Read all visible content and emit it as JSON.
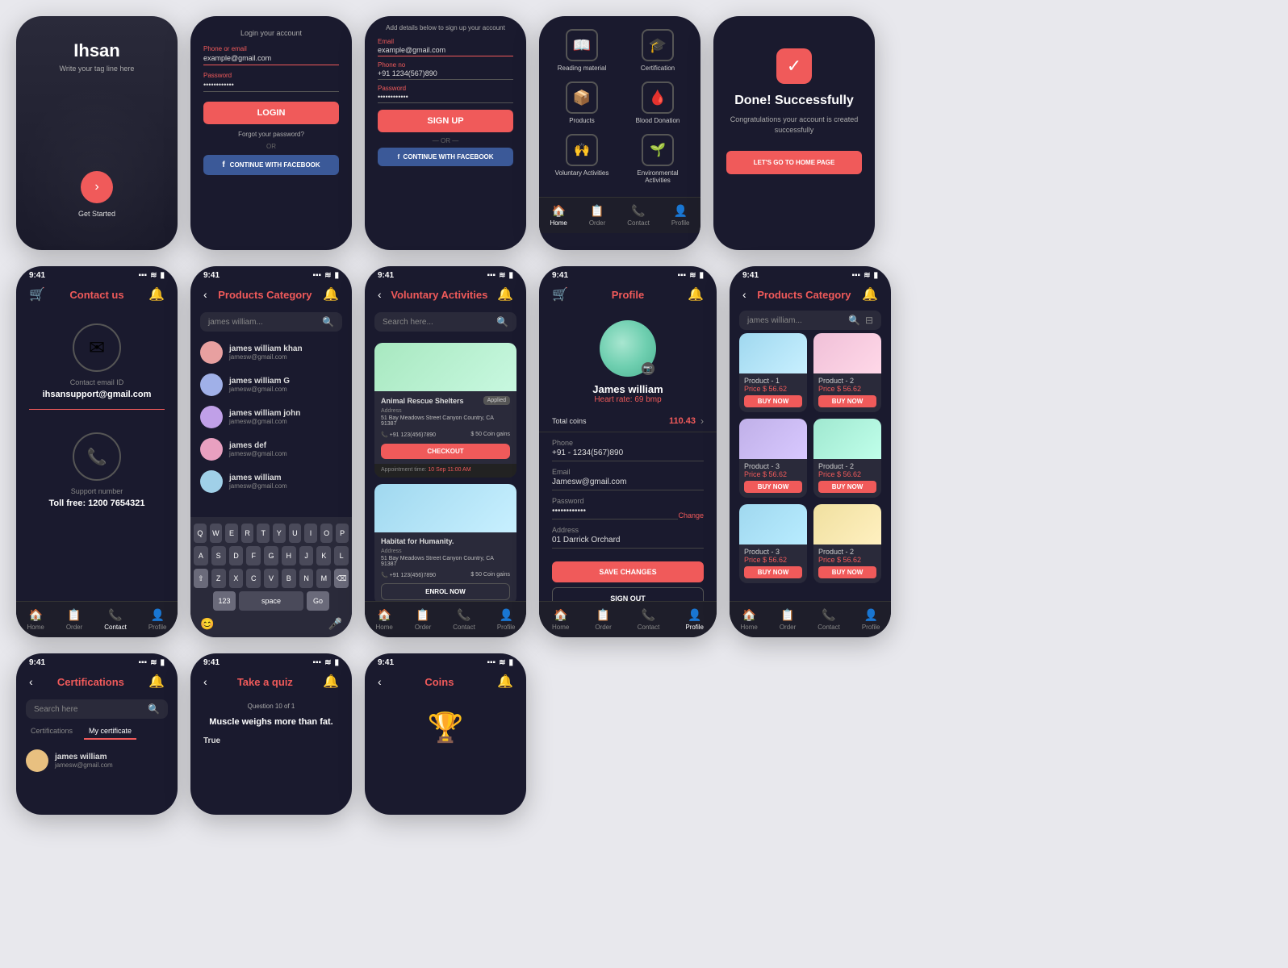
{
  "screens": {
    "welcome": {
      "title": "Ihsan",
      "subtitle": "Write your tag line here",
      "cta": "Get Started"
    },
    "login": {
      "topText": "Login your account",
      "emailLabel": "Phone or email",
      "emailPlaceholder": "example@gmail.com",
      "passwordLabel": "Password",
      "passwordValue": "••••••••••••",
      "loginBtn": "LOGIN",
      "forgotText": "Forgot your password?",
      "orText": "OR",
      "facebookBtn": "CONTINUE WITH FACEBOOK"
    },
    "signup": {
      "topText": "Add details below to sign up your account",
      "emailLabel": "Email",
      "emailPlaceholder": "example@gmail.com",
      "phoneLabel": "Phone no",
      "phonePlaceholder": "+91  1234(567)890",
      "passwordLabel": "Password",
      "passwordValue": "••••••••••••",
      "signupBtn": "SIGN UP",
      "orText": "OR",
      "facebookBtn": "CONTINUE WITH FACEBOOK"
    },
    "categories": {
      "items": [
        {
          "icon": "📖",
          "label": "Reading material"
        },
        {
          "icon": "🎓",
          "label": "Certification"
        },
        {
          "icon": "📦",
          "label": "Products"
        },
        {
          "icon": "🩸",
          "label": "Blood Donation"
        },
        {
          "icon": "🙌",
          "label": "Voluntary Activities"
        },
        {
          "icon": "🌱",
          "label": "Environmental Activities"
        }
      ],
      "bottomNav": [
        "Home",
        "Order",
        "Contact",
        "Profile"
      ]
    },
    "success": {
      "icon": "✓",
      "title": "Done! Successfully",
      "subtitle": "Congratulations your account is created successfully",
      "btn": "LET'S GO TO HOME PAGE"
    },
    "contactUs": {
      "title": "Contact us",
      "emailIcon": "✉",
      "emailLabel": "Contact email ID",
      "email": "ihsansupport@gmail.com",
      "phoneIcon": "📞",
      "phoneLabel": "Support number",
      "phone": "Toll free: 1200 7654321",
      "bottomNav": [
        "Home",
        "Order",
        "Contact",
        "Profile"
      ]
    },
    "productsCategory1": {
      "title": "Products Category",
      "searchPlaceholder": "james william...",
      "contacts": [
        {
          "name": "james william khan",
          "email": "jamesw@gmail.com",
          "color": "#e8a0a0"
        },
        {
          "name": "james william G",
          "email": "jamesw@gmail.com",
          "color": "#a0b0e8"
        },
        {
          "name": "james william john",
          "email": "jamesw@gmail.com",
          "color": "#c0a0e8"
        },
        {
          "name": "james def",
          "email": "jamesw@gmail.com",
          "color": "#e8a0c0"
        },
        {
          "name": "james william",
          "email": "jamesw@gmail.com",
          "color": "#a0d0e8"
        }
      ]
    },
    "voluntaryActivities": {
      "title": "Voluntary Activities",
      "searchPlaceholder": "Search here...",
      "items": [
        {
          "name": "Animal Rescue Shelters",
          "tag": "Applied",
          "address": "51 Bay Meadows Street Canyon Country, CA 91387",
          "phone": "+91 123(456)7890",
          "coins": "50 Coin gains",
          "checkoutBtn": "CHECKOUT",
          "appointmentTime": "10 Sep 11:00 AM"
        },
        {
          "name": "Habitat for Humanity.",
          "address": "51 Bay Meadows Street Canyon Country, CA 91387",
          "phone": "+91 123(456)7890",
          "coins": "50 Coin gains",
          "enrollBtn": "ENROL NOW"
        }
      ],
      "bottomNav": [
        "Home",
        "Order",
        "Contact",
        "Profile"
      ]
    },
    "profile": {
      "title": "Profile",
      "name": "James william",
      "heartRate": "Heart rate: 69 bmp",
      "totalCoins": "Total coins",
      "coinsValue": "110.43",
      "phone": "+91 -   1234(567)890",
      "email": "Jamesw@gmail.com",
      "password": "••••••••••••",
      "changeText": "Change",
      "address": "01 Darrick Orchard",
      "saveBtn": "SAVE CHANGES",
      "signOutBtn": "SIGN OUT",
      "bottomNav": [
        "Home",
        "Order",
        "Contact",
        "Profile"
      ]
    },
    "productsCategory2": {
      "title": "Products Category",
      "searchPlaceholder": "james william...",
      "products": [
        {
          "name": "Product - 1",
          "price": "Price $ 56.62",
          "thumbGrad": "linear-gradient(135deg, #a0d8ef, #c8f0ff)"
        },
        {
          "name": "Product - 2",
          "price": "Price $ 56.62",
          "thumbGrad": "linear-gradient(135deg, #f0c0d8, #ffd8e8)"
        },
        {
          "name": "Product - 3",
          "price": "Price $ 56.62",
          "thumbGrad": "linear-gradient(135deg, #c0b0e8, #d8c8ff)"
        },
        {
          "name": "Product - 2",
          "price": "Price $ 56.62",
          "thumbGrad": "linear-gradient(135deg, #a0e8d0, #c0ffea)"
        },
        {
          "name": "Product - 3",
          "price": "Price $ 56.62",
          "thumbGrad": "linear-gradient(135deg, #a0d8ef, #b8ecff)"
        },
        {
          "name": "Product - 2",
          "price": "Price $ 56.62",
          "thumbGrad": "linear-gradient(135deg, #f0e0a0, #fff0c0)"
        }
      ],
      "buyBtn": "BUY NOW",
      "bottomNav": [
        "Home",
        "Order",
        "Contact",
        "Profile"
      ]
    },
    "certifications": {
      "title": "Certifications",
      "searchPlaceholder": "Search here",
      "tabs": [
        "Certifications",
        "My certificate"
      ],
      "activeTab": "My certificate",
      "user": {
        "name": "james william",
        "email": "jamesw@gmail.com",
        "color": "#e8c080"
      }
    },
    "quiz": {
      "title": "Take a quiz",
      "questionProgress": "Question 10 of 1",
      "question": "Muscle weighs more than fat.",
      "trueLabel": "True"
    },
    "coins": {
      "title": "Coins"
    }
  }
}
